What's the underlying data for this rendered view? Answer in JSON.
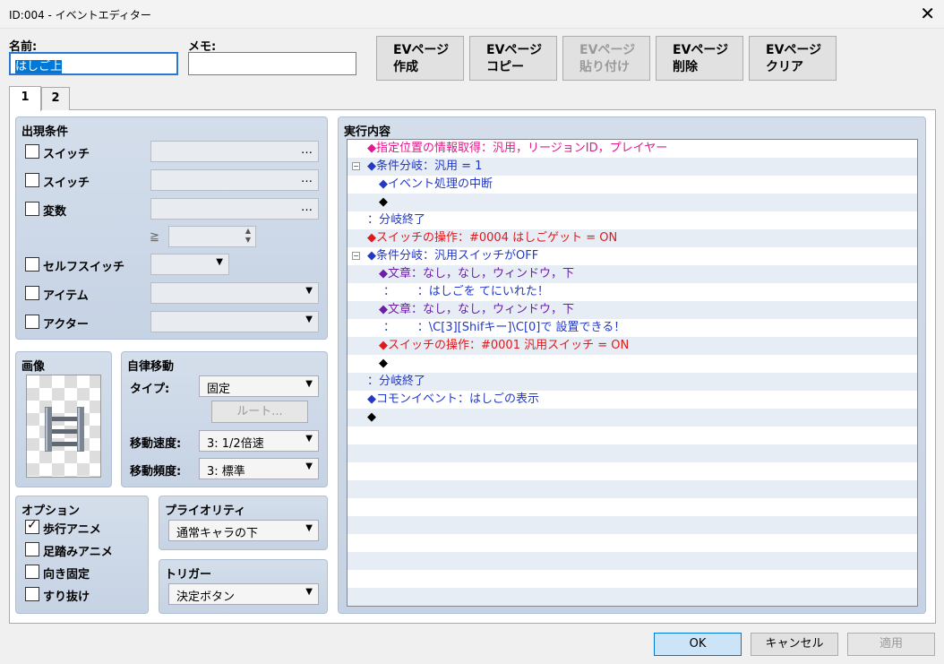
{
  "window": {
    "title": "ID:004 - イベントエディター"
  },
  "header": {
    "name_label": "名前:",
    "name_value": "はしご上",
    "memo_label": "メモ:",
    "memo_value": ""
  },
  "toolbar": {
    "new_line1": "EVページ",
    "new_line2": "作成",
    "copy_line1": "EVページ",
    "copy_line2": "コピー",
    "paste_line1": "EVページ",
    "paste_line2": "貼り付け",
    "delete_line1": "EVページ",
    "delete_line2": "削除",
    "clear_line1": "EVページ",
    "clear_line2": "クリア"
  },
  "tabs": [
    "1",
    "2"
  ],
  "conditions": {
    "title": "出現条件",
    "switch1": "スイッチ",
    "switch2": "スイッチ",
    "variable": "変数",
    "ge": "≧",
    "self_switch": "セルフスイッチ",
    "item": "アイテム",
    "actor": "アクター",
    "dots": "…"
  },
  "image": {
    "title": "画像"
  },
  "autonomous": {
    "title": "自律移動",
    "type_label": "タイプ:",
    "type_value": "固定",
    "route_button": "ルート...",
    "speed_label": "移動速度:",
    "speed_value": "3: 1/2倍速",
    "freq_label": "移動頻度:",
    "freq_value": "3: 標準"
  },
  "options": {
    "title": "オプション",
    "walking": "歩行アニメ",
    "stepping": "足踏みアニメ",
    "direction_fix": "向き固定",
    "through": "すり抜け"
  },
  "priority": {
    "title": "プライオリティ",
    "value": "通常キャラの下"
  },
  "trigger": {
    "title": "トリガー",
    "value": "決定ボタン"
  },
  "contents": {
    "title": "実行内容",
    "rows": [
      "◆指定位置の情報取得：汎用，リージョンID，プレイヤー",
      "◆条件分岐：汎用 = 1",
      "◆イベント処理の中断",
      "◆",
      "：分岐終了",
      "◆スイッチの操作：#0004 はしごゲット = ON",
      "◆条件分岐：汎用スイッチがOFF",
      "◆文章：なし，なし，ウィンドウ，下",
      "：      ：はしごを てにいれた！",
      "◆文章：なし，なし，ウィンドウ，下",
      "：      ：\\C[3][Shifキー]\\C[0]で 設置できる！",
      "◆スイッチの操作：#0001 汎用スイッチ = ON",
      "◆",
      "：分岐終了",
      "◆コモンイベント：はしごの表示",
      "◆"
    ]
  },
  "footer": {
    "ok": "OK",
    "cancel": "キャンセル",
    "apply": "適用"
  },
  "colors": {
    "accent": "#0078d7",
    "pink": "#e0198c",
    "red": "#e0191d",
    "blue": "#2238c8"
  }
}
